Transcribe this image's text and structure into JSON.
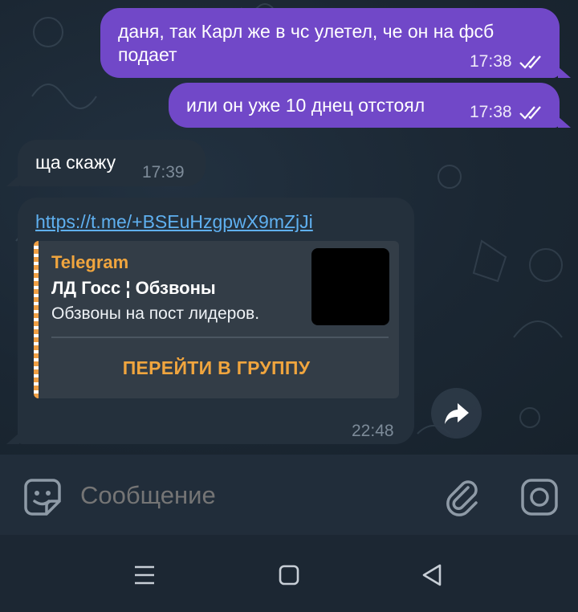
{
  "messages": [
    {
      "direction": "out",
      "text_line1": "даня, так Карл же в чс улетел, че он на фсб",
      "text_line2": "подает",
      "time": "17:38",
      "status": "read"
    },
    {
      "direction": "out",
      "text": "или он уже 10 днец отстоял",
      "time": "17:38",
      "status": "read"
    },
    {
      "direction": "in",
      "text": "ща скажу",
      "time": "17:39"
    },
    {
      "direction": "in",
      "link": "https://t.me/+BSEuHzgpwX9mZjJi",
      "time": "22:48",
      "preview": {
        "site": "Telegram",
        "title": "ЛД Госс ¦ Обзвоны",
        "description": "Обзвоны на пост лидеров.",
        "button": "ПЕРЕЙТИ В ГРУППУ"
      }
    }
  ],
  "composer": {
    "placeholder": "Сообщение"
  },
  "icons": {
    "read_status": "double-check-icon",
    "share": "share-arrow-icon",
    "emoji": "sticker-emoji-icon",
    "attach": "paperclip-icon",
    "camera": "camera-icon",
    "nav": [
      "recent-apps-icon",
      "home-icon",
      "back-icon"
    ]
  },
  "colors": {
    "outgoing_bubble": "#7148c8",
    "incoming_bubble": "#24303c",
    "link": "#5fb0f0",
    "accent_orange": "#f0a53e",
    "chat_background": "#1b2733"
  }
}
